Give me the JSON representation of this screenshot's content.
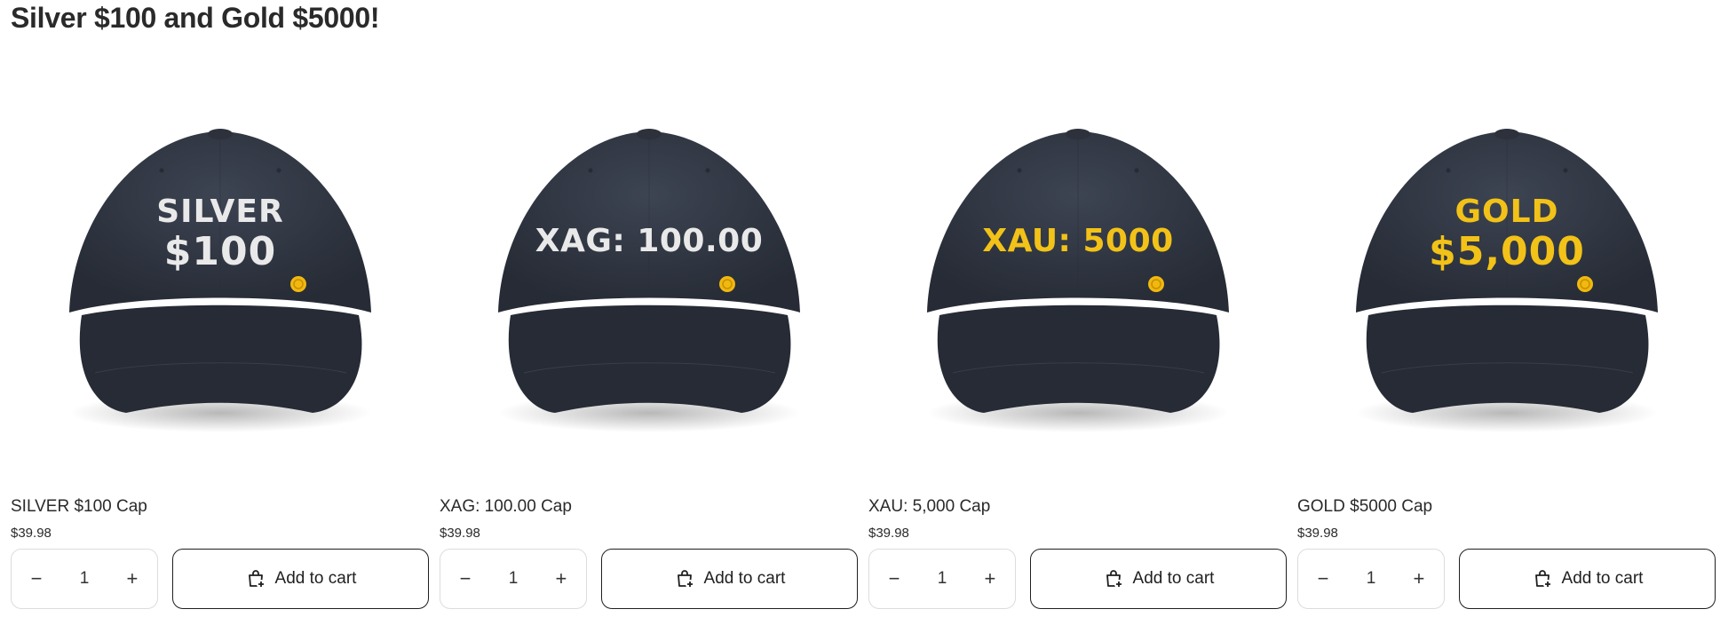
{
  "page": {
    "title": "Silver $100 and Gold $5000!"
  },
  "products": [
    {
      "name": "SILVER $100 Cap",
      "price": "$39.98",
      "quantity": "1",
      "add_label": "Add to cart",
      "cap_text": [
        "SILVER",
        "$100"
      ],
      "text_color": "#e9e9ea"
    },
    {
      "name": "XAG: 100.00 Cap",
      "price": "$39.98",
      "quantity": "1",
      "add_label": "Add to cart",
      "cap_text": [
        "XAG: 100.00"
      ],
      "text_color": "#e9e9ea"
    },
    {
      "name": "XAU: 5,000 Cap",
      "price": "$39.98",
      "quantity": "1",
      "add_label": "Add to cart",
      "cap_text": [
        "XAU: 5000"
      ],
      "text_color": "#f2c218"
    },
    {
      "name": "GOLD $5000 Cap",
      "price": "$39.98",
      "quantity": "1",
      "add_label": "Add to cart",
      "cap_text": [
        "GOLD",
        "$5,000"
      ],
      "text_color": "#f2c218"
    }
  ],
  "icons": {
    "minus": "minus-icon",
    "plus": "plus-icon",
    "cart": "cart-add-icon"
  },
  "colors": {
    "cap": "#343a47",
    "cap_dark": "#262b35",
    "coin": "#f1b90f"
  }
}
